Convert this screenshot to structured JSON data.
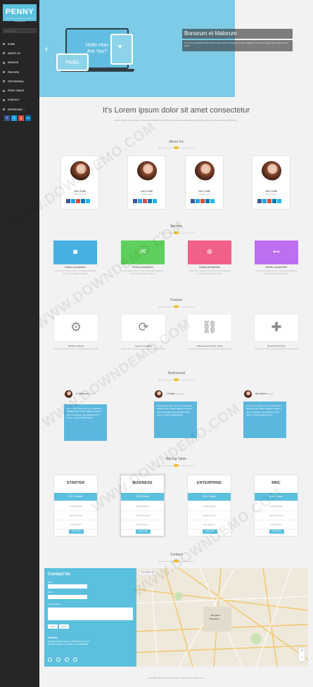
{
  "brand": {
    "name": "PENNY",
    "tagline": "Creative Multipurpose Template"
  },
  "sidebar": {
    "search_placeholder": "Search here",
    "items": [
      {
        "label": "HOME",
        "icon": "home-icon"
      },
      {
        "label": "ABOUT US",
        "icon": "user-icon"
      },
      {
        "label": "SERVICE",
        "icon": "gear-icon"
      },
      {
        "label": "FEATURE",
        "icon": "star-icon"
      },
      {
        "label": "TESTIMONIAL",
        "icon": "comment-icon"
      },
      {
        "label": "PRICE TABLE",
        "icon": "tag-icon"
      },
      {
        "label": "CONTACT",
        "icon": "mail-icon"
      },
      {
        "label": "DROPDOWN ⌄",
        "icon": "list-icon"
      }
    ],
    "social": [
      {
        "label": "f",
        "color": "#3b5998"
      },
      {
        "label": "t",
        "color": "#1da1f2"
      },
      {
        "label": "g",
        "color": "#dd4b39"
      },
      {
        "label": "in",
        "color": "#0077b5"
      }
    ]
  },
  "hero": {
    "screen_text": "Hello How Are You?",
    "phone_text": "Hello",
    "title": "Bonorum et Malorum",
    "text": "It is a long established fact that a reader will be distracted by the readable content of a page when looking at its layout."
  },
  "intro": {
    "heading": "It's Lorem ipsum dolor sit amet consectetur",
    "subtext": "Lorem ipsum dolor sit amet, consectetur adipiscing elit. Donec consectetur adipiscing elit tristique ac amet vitae tincidunt adipiscing."
  },
  "sections": {
    "about": "About Us",
    "service": "Service",
    "feature": "Feature",
    "testimonial": "Testimonial",
    "pricing": "Pricing Table",
    "contact": "Contact"
  },
  "team": [
    {
      "name": "John Smith",
      "role": "Web Designer"
    },
    {
      "name": "John Smith",
      "role": "Web Designer"
    },
    {
      "name": "John Smith",
      "role": "Web Designer"
    },
    {
      "name": "John Smith",
      "role": "Web Designer"
    }
  ],
  "services": [
    {
      "name": "Unique perspective",
      "color": "#46b0e3",
      "icon": "camera-icon",
      "desc": "Lorem ipsum dolor sit amet, consectetur adipiscing elit, tempor incididunt ut labore."
    },
    {
      "name": "Perfect perspective",
      "color": "#5fd05d",
      "icon": "envelope-icon",
      "desc": "Lorem ipsum dolor sit amet, consectetur adipiscing elit, tempor incididunt ut labore."
    },
    {
      "name": "Classic perspective",
      "color": "#f06088",
      "icon": "download-icon",
      "desc": "Lorem ipsum dolor sit amet, consectetur adipiscing elit, tempor incididunt ut labore."
    },
    {
      "name": "Modern perspective",
      "color": "#bd6ff2",
      "icon": "gamepad-icon",
      "desc": "Lorem ipsum dolor sit amet, consectetur adipiscing elit, tempor incididunt ut labore."
    }
  ],
  "features": [
    {
      "name": "Multiple Settings",
      "icon": "gears-icon",
      "desc": "Lorem ipsum dolor sit amet, consectetur adipiscing elit."
    },
    {
      "name": "Secure & Updates",
      "icon": "refresh-icon",
      "desc": "Lorem ipsum dolor sit amet, consectetur adipiscing elit."
    },
    {
      "name": "Independent Network Setup",
      "icon": "chain-icon",
      "desc": "Lorem ipsum dolor sit amet, consectetur adipiscing elit."
    },
    {
      "name": "Blocked By Scripts",
      "icon": "puzzle-icon",
      "desc": "Lorem ipsum dolor sit amet, consectetur adipiscing elit."
    }
  ],
  "testimonials": [
    {
      "name": "E. Anderson",
      "role": "Designer",
      "text": "Lorem ipsum dolor sit amet, consectetur adipiscing elit. Nullam dapibus mauris in lacus consequat, eget dignissim tortor dictum. Vivamus blandit lorem."
    },
    {
      "name": "J. Martin",
      "role": "Developer",
      "text": "Lorem ipsum dolor sit amet, consectetur adipiscing elit. Nullam dapibus mauris in lacus consequat, eget dignissim tortor dictum. Vivamus blandit lorem."
    },
    {
      "name": "Mini Albert",
      "role": "Manager",
      "text": "Lorem ipsum dolor sit amet, consectetur adipiscing elit. Nullam dapibus mauris in lacus consequat, eget dignissim tortor dictum. Vivamus blandit lorem."
    }
  ],
  "pricing": [
    {
      "name": "STARTER",
      "price": "$ 19 / Month",
      "rows": [
        "10 GB Storage",
        "1 Email Account",
        "24/7 Support"
      ],
      "button": "Buy It Now"
    },
    {
      "name": "BUSINESS",
      "price": "$ 29 / Month",
      "rows": [
        "10 GB Storage",
        "1 Email Account",
        "24/7 Support"
      ],
      "button": "Buy It Now"
    },
    {
      "name": "ENTERPRISE",
      "price": "$ 39 / Month",
      "rows": [
        "10 GB Storage",
        "1 Email Account",
        "24/7 Support"
      ],
      "button": "Buy It Now"
    },
    {
      "name": "MNC",
      "price": "$ 49 / Month",
      "rows": [
        "10 GB Storage",
        "1 Email Account",
        "24/7 Support"
      ],
      "button": "Buy It Now"
    }
  ],
  "contact": {
    "title": "Contact Us",
    "name_label": "Name",
    "email_label": "Email",
    "message_label": "Your Message",
    "send": "Send",
    "reset": "Reset",
    "address_title": "Address",
    "address": "Bengaluru Silicon Valley, Inc. 795 Folsom Ave, Suite 600, San Francisco, CA 94107 P: (123) 456-7890"
  },
  "map": {
    "view_label": "View larger map",
    "city": "Bengaluru",
    "city2": "Bangalore"
  },
  "footer": "Copyright 2015 - Penny Website - Crafted from gridgum.com",
  "watermark": "WWW.DOWNDEMO.COM"
}
